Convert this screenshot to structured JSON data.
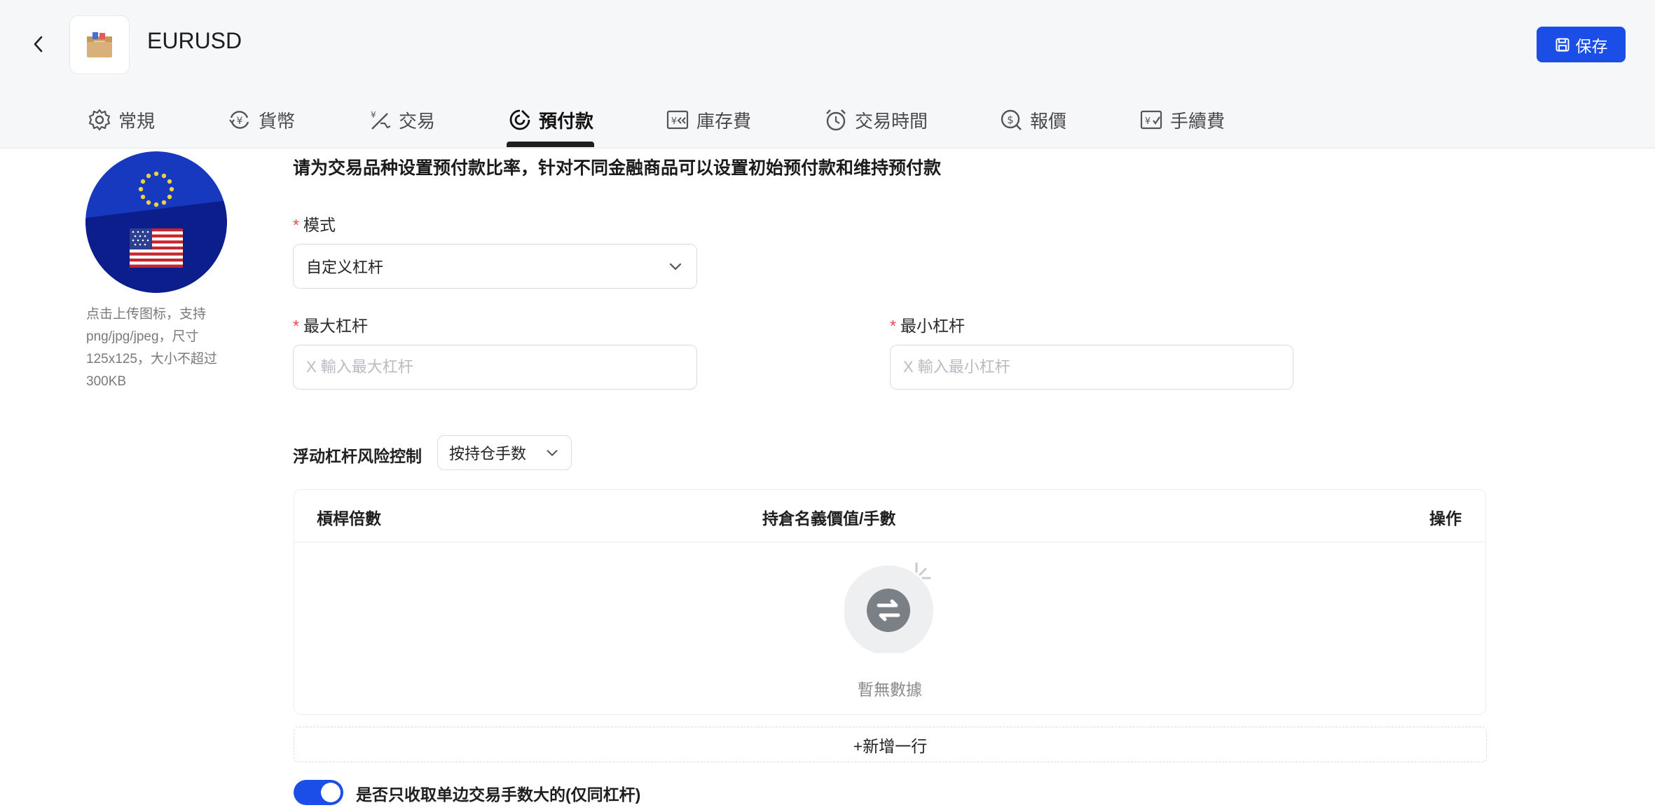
{
  "header": {
    "title": "EURUSD",
    "save_label": "保存"
  },
  "tabs": [
    {
      "label": "常規",
      "icon": "gear-icon"
    },
    {
      "label": "貨幣",
      "icon": "currency-exchange-icon"
    },
    {
      "label": "交易",
      "icon": "trade-icon"
    },
    {
      "label": "預付款",
      "icon": "margin-icon",
      "active": true
    },
    {
      "label": "庫存費",
      "icon": "swap-fee-icon"
    },
    {
      "label": "交易時間",
      "icon": "alarm-clock-icon"
    },
    {
      "label": "報價",
      "icon": "quote-icon"
    },
    {
      "label": "手續費",
      "icon": "commission-icon"
    }
  ],
  "upload": {
    "hint_lines": [
      "点击上传图标，支持",
      "png/jpg/jpeg，尺寸",
      "125x125，大小不超过",
      "300KB"
    ]
  },
  "form": {
    "description": "请为交易品种设置预付款比率，针对不同金融商品可以设置初始预付款和维持预付款",
    "mode": {
      "label": "模式",
      "value": "自定义杠杆"
    },
    "max_leverage": {
      "label": "最大杠杆",
      "placeholder": "X 輸入最大杠杆"
    },
    "min_leverage": {
      "label": "最小杠杆",
      "placeholder": "X 輸入最小杠杆"
    },
    "risk_control": {
      "label": "浮动杠杆风险控制",
      "value": "按持仓手数"
    },
    "table": {
      "columns": [
        "槓桿倍數",
        "持倉名義價值/手數",
        "操作"
      ],
      "empty_text": "暫無數據"
    },
    "add_row_label": "+新增一行",
    "one_side_fee": {
      "label": "是否只收取单边交易手数大的(仅同杠杆)",
      "enabled": true
    }
  },
  "colors": {
    "accent": "#1a4ee6",
    "required": "#e5484d"
  }
}
